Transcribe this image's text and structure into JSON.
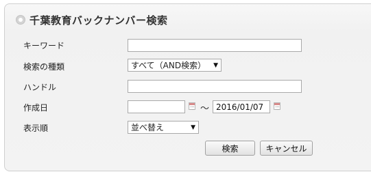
{
  "panel": {
    "title": "千葉教育バックナンバー検索"
  },
  "form": {
    "keyword": {
      "label": "キーワード",
      "value": ""
    },
    "search_type": {
      "label": "検索の種類",
      "selected": "すべて（AND検索）"
    },
    "handle": {
      "label": "ハンドル",
      "value": ""
    },
    "created_date": {
      "label": "作成日",
      "from_value": "",
      "separator": "～",
      "to_value": "2016/01/07"
    },
    "display_order": {
      "label": "表示順",
      "selected": "並べ替え"
    }
  },
  "buttons": {
    "search": "検索",
    "cancel": "キャンセル"
  }
}
